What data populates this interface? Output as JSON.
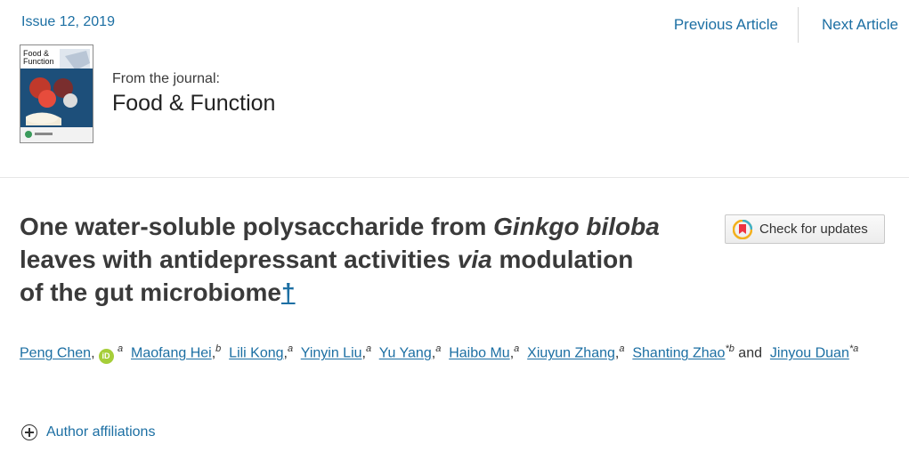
{
  "issue": "Issue 12, 2019",
  "nav": {
    "previous": "Previous Article",
    "next": "Next Article"
  },
  "journal": {
    "from_label": "From the journal:",
    "name": "Food & Function",
    "cover_title_line1": "Food &",
    "cover_title_line2": "Function"
  },
  "article": {
    "title_part1": "One water-soluble polysaccharide from ",
    "title_italic1": "Ginkgo biloba",
    "title_part2": " leaves with antidepressant activities ",
    "title_italic2": "via",
    "title_part3": " modulation of the gut microbiome",
    "title_dagger": "†"
  },
  "check_updates": {
    "label": "Check for updates"
  },
  "authors": [
    {
      "name": "Peng Chen",
      "sup": "a",
      "orcid": true
    },
    {
      "name": "Maofang Hei",
      "sup": "b"
    },
    {
      "name": "Lili Kong",
      "sup": "a"
    },
    {
      "name": "Yinyin Liu",
      "sup": "a"
    },
    {
      "name": "Yu Yang",
      "sup": "a"
    },
    {
      "name": "Haibo Mu",
      "sup": "a"
    },
    {
      "name": "Xiuyun Zhang",
      "sup": "a"
    },
    {
      "name": "Shanting Zhao",
      "sup": "*b"
    },
    {
      "name": "Jinyou Duan",
      "sup": "*a"
    }
  ],
  "authors_and": "and",
  "orcid_label": "iD",
  "affiliations_label": "Author affiliations",
  "colors": {
    "link": "#1c6fa3",
    "orcid": "#a6ce39",
    "title": "#3a3a3a"
  }
}
